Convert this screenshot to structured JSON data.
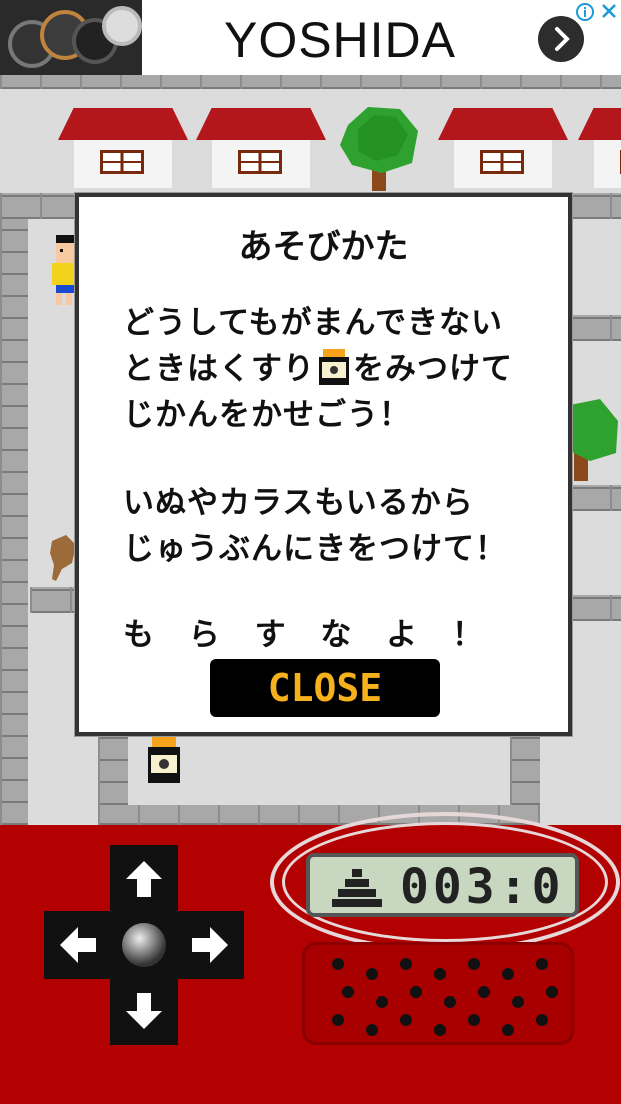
{
  "ad": {
    "brand": "YOSHIDA",
    "icons": [
      "ad-info-icon",
      "ad-close-icon",
      "chevron-right-icon"
    ]
  },
  "dialog": {
    "title": "あそびかた",
    "lines": [
      "どうしてもがまんできない",
      "ときはくすり",
      "をみつけて",
      "じかんをかせごう！",
      "いぬやカラスもいるから",
      "じゅうぶんにきをつけて！",
      "も ら す な よ ！"
    ],
    "close_label": "CLOSE"
  },
  "lcd": {
    "icon": "poop-icon",
    "value": "003:0"
  },
  "dpad": {
    "icons": [
      "arrow-up-icon",
      "arrow-left-icon",
      "arrow-right-icon",
      "arrow-down-icon"
    ]
  },
  "colors": {
    "controller_bg": "#b30000",
    "button_text": "#f7b11c",
    "roof": "#b3171b"
  }
}
